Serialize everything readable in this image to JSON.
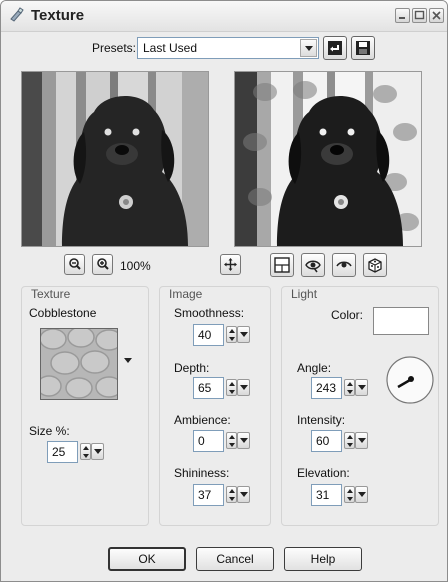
{
  "window": {
    "title": "Texture",
    "controls": [
      "minimize-icon",
      "maximize-icon",
      "close-icon"
    ]
  },
  "presets": {
    "label": "Presets:",
    "value": "Last Used"
  },
  "zoom": {
    "level": "100%"
  },
  "texture": {
    "group_label": "Texture",
    "name": "Cobblestone",
    "size_label": "Size %:",
    "size_value": "25"
  },
  "image": {
    "group_label": "Image",
    "smoothness": {
      "label": "Smoothness:",
      "value": "40"
    },
    "depth": {
      "label": "Depth:",
      "value": "65"
    },
    "ambience": {
      "label": "Ambience:",
      "value": "0"
    },
    "shininess": {
      "label": "Shininess:",
      "value": "37"
    }
  },
  "light": {
    "group_label": "Light",
    "color_label": "Color:",
    "color_value": "#ffffff",
    "angle": {
      "label": "Angle:",
      "value": "243"
    },
    "intensity": {
      "label": "Intensity:",
      "value": "60"
    },
    "elevation": {
      "label": "Elevation:",
      "value": "31"
    }
  },
  "buttons": {
    "ok": "OK",
    "cancel": "Cancel",
    "help": "Help"
  }
}
